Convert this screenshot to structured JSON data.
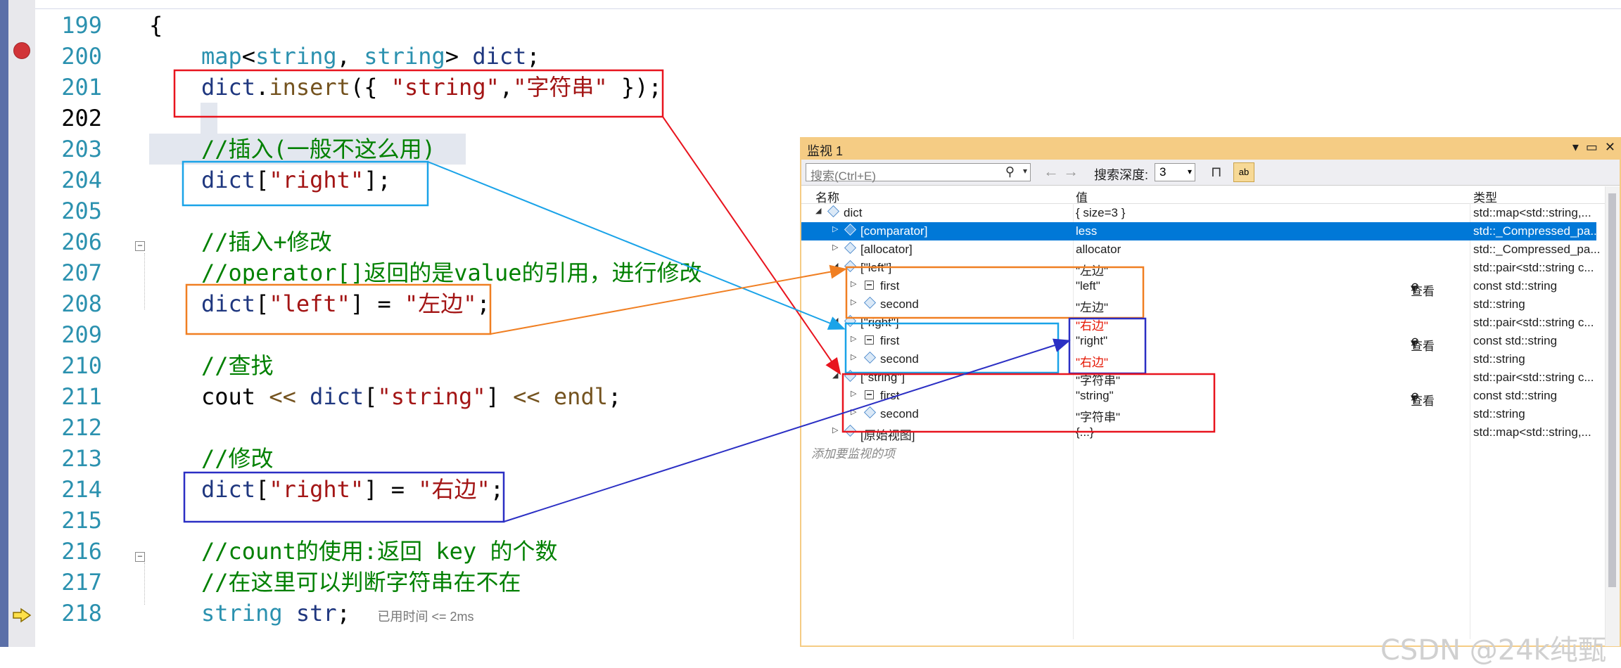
{
  "editor": {
    "lines": [
      {
        "num": "199"
      },
      {
        "num": "200"
      },
      {
        "num": "201"
      },
      {
        "num": "202"
      },
      {
        "num": "203"
      },
      {
        "num": "204"
      },
      {
        "num": "205"
      },
      {
        "num": "206"
      },
      {
        "num": "207"
      },
      {
        "num": "208"
      },
      {
        "num": "209"
      },
      {
        "num": "210"
      },
      {
        "num": "211"
      },
      {
        "num": "212"
      },
      {
        "num": "213"
      },
      {
        "num": "214"
      },
      {
        "num": "215"
      },
      {
        "num": "216"
      },
      {
        "num": "217"
      },
      {
        "num": "218"
      }
    ],
    "code": {
      "l199_brace": "{",
      "l200_map": "map",
      "l200_lt": "<",
      "l200_string1": "string",
      "l200_comma": ", ",
      "l200_string2": "string",
      "l200_gt": "> ",
      "l200_dict": "dict",
      "l200_semi": ";",
      "l201_dict": "dict",
      "l201_dot": ".",
      "l201_insert": "insert",
      "l201_open": "({ ",
      "l201_s1": "\"string\"",
      "l201_c": ",",
      "l201_s2": "\"字符串\"",
      "l201_close": " });",
      "l203_cmt": "//插入(一般不这么用)",
      "l204_dict": "dict",
      "l204_ob": "[",
      "l204_s": "\"right\"",
      "l204_cb": "];",
      "l206_cmt": "//插入+修改",
      "l207_cmt": "//operator[]返回的是value的引用，进行修改",
      "l208_dict": "dict",
      "l208_ob": "[",
      "l208_s": "\"left\"",
      "l208_cb": "] = ",
      "l208_v": "\"左边\"",
      "l208_semi": ";",
      "l210_cmt": "//查找",
      "l211_cout": "cout",
      "l211_op1": " << ",
      "l211_dict": "dict",
      "l211_ob": "[",
      "l211_s": "\"string\"",
      "l211_cb": "]",
      "l211_op2": " << ",
      "l211_endl": "endl",
      "l211_semi": ";",
      "l213_cmt": "//修改",
      "l214_dict": "dict",
      "l214_ob": "[",
      "l214_s": "\"right\"",
      "l214_cb": "] = ",
      "l214_v": "\"右边\"",
      "l214_semi": ";",
      "l216_cmt": "//count的使用:返回 key 的个数",
      "l217_cmt": "//在这里可以判断字符串在不在",
      "l218_type": "string",
      "l218_var": " str",
      "l218_semi": ";",
      "l218_hint": "已用时间 <= 2ms"
    },
    "fold_minus": "−"
  },
  "watch": {
    "title": "监视 1",
    "controls": {
      "dropdown": "▾",
      "maximize": "▭",
      "close": "✕"
    },
    "search_placeholder": "搜索(Ctrl+E)",
    "search_icon_glyph": "⚲",
    "dd_glyph": "▾",
    "nav_back": "←",
    "nav_fwd": "→",
    "depth_label": "搜索深度:",
    "depth_value": "3",
    "pin_glyph": "⊓",
    "ab_glyph": "ab",
    "headers": {
      "name": "名称",
      "value": "值",
      "type": "类型"
    },
    "view_label": "查看",
    "rows": [
      {
        "name": "dict",
        "value": "{ size=3 }",
        "type": "std::map<std::string,..."
      },
      {
        "name": "[comparator]",
        "value": "less",
        "type": "std::_Compressed_pa..."
      },
      {
        "name": "[allocator]",
        "value": "allocator",
        "type": "std::_Compressed_pa..."
      },
      {
        "name": "[\"left\"]",
        "value": "\"左边\"",
        "type": "std::pair<std::string c..."
      },
      {
        "name": "first",
        "value": "\"left\"",
        "type": "const std::string"
      },
      {
        "name": "second",
        "value": "\"左边\"",
        "type": "std::string"
      },
      {
        "name": "[\"right\"]",
        "value": "\"右边\"",
        "type": "std::pair<std::string c..."
      },
      {
        "name": "first",
        "value": "\"right\"",
        "type": "const std::string"
      },
      {
        "name": "second",
        "value": "\"右边\"",
        "type": "std::string"
      },
      {
        "name": "[\"string\"]",
        "value": "\"字符串\"",
        "type": "std::pair<std::string c..."
      },
      {
        "name": "first",
        "value": "\"string\"",
        "type": "const std::string"
      },
      {
        "name": "second",
        "value": "\"字符串\"",
        "type": "std::string"
      },
      {
        "name": "[原始视图]",
        "value": "{...}",
        "type": "std::map<std::string,..."
      }
    ],
    "add_item": "添加要监视的项",
    "changed_color": "#e51400"
  },
  "watermark": "CSDN @24k纯甄",
  "annotation_colors": {
    "red": "#e8141e",
    "cyan": "#1aa3e8",
    "orange": "#f07f22",
    "blue": "#2b2fc4"
  }
}
